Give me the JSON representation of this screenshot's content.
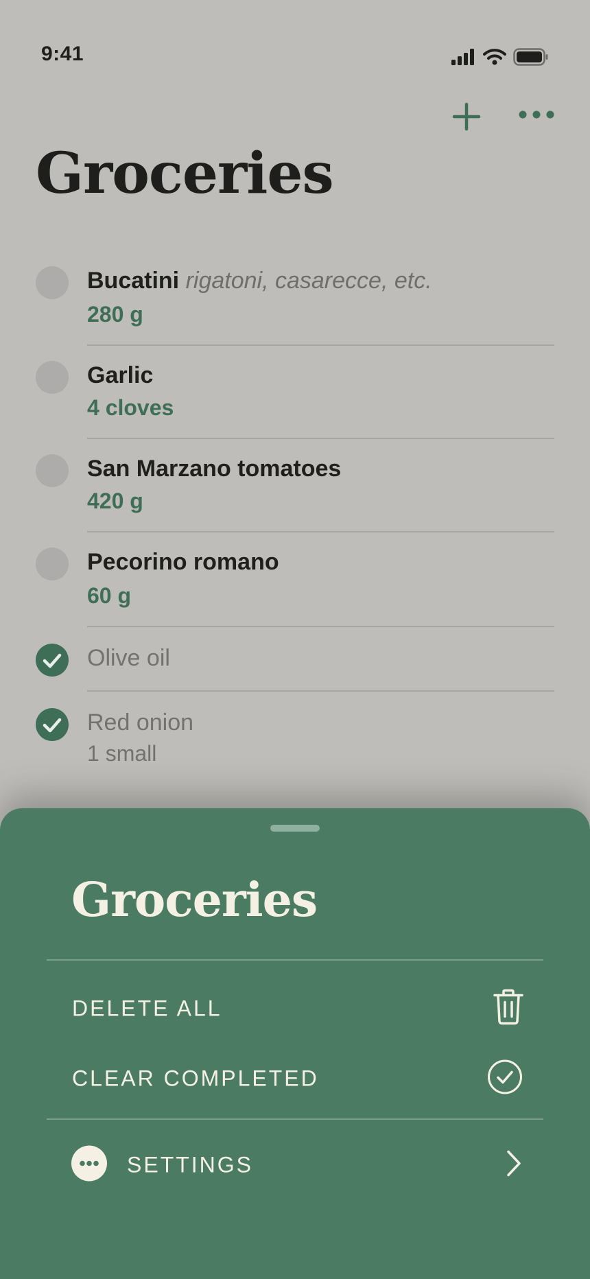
{
  "status_bar": {
    "time": "9:41"
  },
  "header": {
    "title": "Groceries",
    "add_icon": "plus-icon",
    "more_icon": "ellipsis-icon"
  },
  "items": [
    {
      "name": "Bucatini",
      "note": "rigatoni, casarecce, etc.",
      "qty": "280 g",
      "checked": false
    },
    {
      "name": "Garlic",
      "note": "",
      "qty": "4 cloves",
      "checked": false
    },
    {
      "name": "San Marzano tomatoes",
      "note": "",
      "qty": "420 g",
      "checked": false
    },
    {
      "name": "Pecorino romano",
      "note": "",
      "qty": "60 g",
      "checked": false
    },
    {
      "name": "Olive oil",
      "note": "",
      "qty": "",
      "checked": true
    },
    {
      "name": "Red onion",
      "note": "",
      "qty": "1 small",
      "checked": true
    }
  ],
  "sheet": {
    "title": "Groceries",
    "delete_all": "DELETE ALL",
    "clear_completed": "CLEAR COMPLETED",
    "settings": "SETTINGS"
  },
  "colors": {
    "background": "#bebdb9",
    "accent_green": "#3f6e56",
    "sheet_green": "#4b7c63",
    "sheet_text": "#f4f1e4"
  }
}
